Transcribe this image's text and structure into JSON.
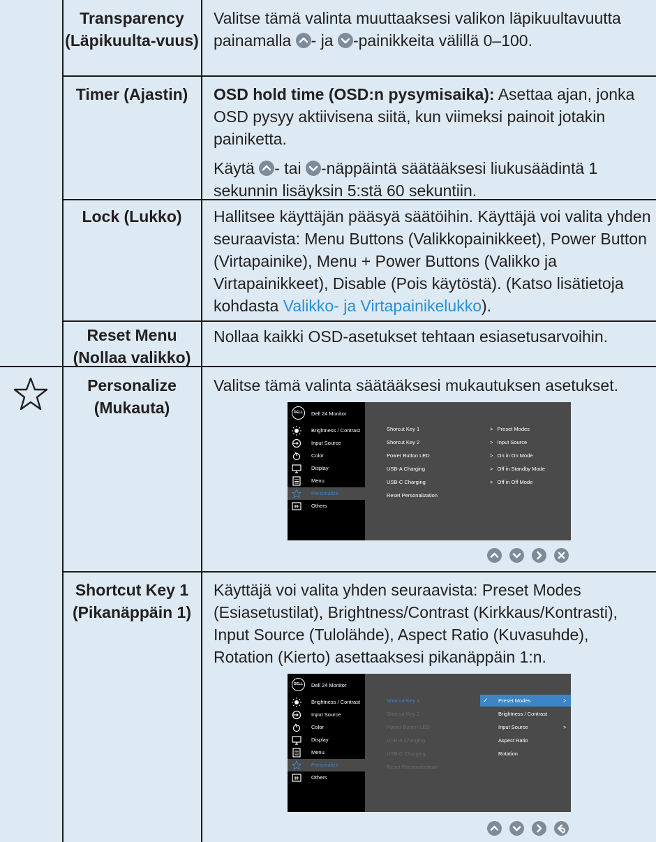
{
  "rows": {
    "transparency": {
      "label": "Transparency (Läpikuulta-vuus)",
      "desc_a": "Valitse tämä valinta muuttaaksesi valikon läpikuultavuutta painamalla ",
      "desc_b": "- ja ",
      "desc_c": "-painikkeita välillä 0–100."
    },
    "timer": {
      "label": "Timer (Ajastin)",
      "bold": "OSD hold time (OSD:n pysymisaika):",
      "p1_rest": " Asettaa ajan, jonka OSD pysyy aktiivisena siitä, kun viimeksi painoit jotakin painiketta.",
      "p2_a": "Käytä ",
      "p2_b": "- tai ",
      "p2_c": "-näppäintä säätääksesi liukusäädintä 1 sekunnin lisäyksin 5:stä 60 sekuntiin."
    },
    "lock": {
      "label": "Lock (Lukko)",
      "desc": "Hallitsee käyttäjän pääsyä säätöihin. Käyttäjä voi valita yhden seuraavista: Menu Buttons (Valikkopainikkeet), Power Button (Virtapainike), Menu + Power Buttons (Valikko ja Virtapainikkeet), Disable (Pois käytöstä). (Katso lisätietoja kohdasta ",
      "link": "Valikko- ja Virtapainikelukko",
      "desc_end": ")."
    },
    "reset": {
      "label": "Reset Menu (Nollaa valikko)",
      "desc": "Nollaa kaikki OSD-asetukset tehtaan esiasetusarvoihin."
    },
    "personalize": {
      "icon": "star-icon",
      "label": "Personalize (Mukauta)",
      "desc": "Valitse tämä valinta säätääksesi mukautuksen asetukset."
    },
    "shortcut1": {
      "label": "Shortcut Key 1 (Pikanäppäin 1)",
      "desc": "Käyttäjä voi valita yhden seuraavista: Preset Modes (Esiasetustilat),  Brightness/Contrast (Kirkkaus/Kontrasti), Input Source (Tulolähde), Aspect Ratio (Kuvasuhde), Rotation (Kierto) asettaaksesi pikanäppäin 1:n."
    }
  },
  "osd": {
    "logo": "DELL",
    "title": "Dell 24 Monitor",
    "menu": [
      "Brightness / Contrast",
      "Input Source",
      "Color",
      "Display",
      "Menu",
      "Personalize",
      "Others"
    ],
    "menu_icons": [
      "brightness-icon",
      "input-source-icon",
      "color-icon",
      "display-icon",
      "menu-icon",
      "star-icon",
      "others-icon"
    ],
    "items": [
      "Shorcut Key 1",
      "Shorcut Key 2",
      "Power Button LED",
      "USB-A Charging",
      "USB-C Charging",
      "Reset Personalization"
    ],
    "values": [
      "Preset Modes",
      "Input Source",
      "On in On Mode",
      "Off in Standby Mode",
      "Off in Off Mode"
    ],
    "options": [
      "Preset Modes",
      "Brightness / Contrast",
      "Input Source",
      "Aspect Ratio",
      "Rotation"
    ],
    "check": "✓",
    "arrow": ">"
  },
  "buttons1": [
    "up-icon",
    "down-icon",
    "right-icon",
    "close-icon"
  ],
  "buttons2": [
    "up-icon",
    "down-icon",
    "right-icon",
    "back-icon"
  ]
}
